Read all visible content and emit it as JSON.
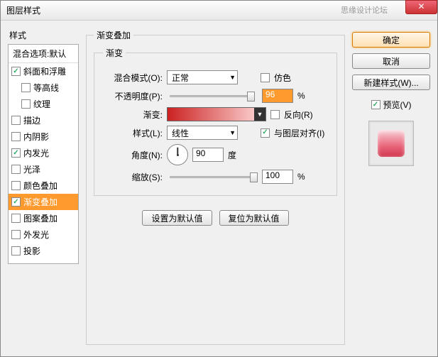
{
  "title": "图层样式",
  "watermark": "思缘设计论坛",
  "left": {
    "header": "样式",
    "blend_options": "混合选项:默认",
    "items": [
      {
        "label": "斜面和浮雕",
        "checked": true,
        "indent": false
      },
      {
        "label": "等高线",
        "checked": false,
        "indent": true
      },
      {
        "label": "纹理",
        "checked": false,
        "indent": true
      },
      {
        "label": "描边",
        "checked": false,
        "indent": false
      },
      {
        "label": "内阴影",
        "checked": false,
        "indent": false
      },
      {
        "label": "内发光",
        "checked": true,
        "indent": false
      },
      {
        "label": "光泽",
        "checked": false,
        "indent": false
      },
      {
        "label": "颜色叠加",
        "checked": false,
        "indent": false
      },
      {
        "label": "渐变叠加",
        "checked": true,
        "indent": false,
        "selected": true
      },
      {
        "label": "图案叠加",
        "checked": false,
        "indent": false
      },
      {
        "label": "外发光",
        "checked": false,
        "indent": false
      },
      {
        "label": "投影",
        "checked": false,
        "indent": false
      }
    ]
  },
  "center": {
    "group_title": "渐变叠加",
    "subgroup_title": "渐变",
    "blend_mode_label": "混合模式(O):",
    "blend_mode_value": "正常",
    "dither_label": "仿色",
    "opacity_label": "不透明度(P):",
    "opacity_value": "96",
    "percent": "%",
    "gradient_label": "渐变:",
    "reverse_label": "反向(R)",
    "style_label": "样式(L):",
    "style_value": "线性",
    "align_label": "与图层对齐(I)",
    "angle_label": "角度(N):",
    "angle_value": "90",
    "degree": "度",
    "scale_label": "缩放(S):",
    "scale_value": "100",
    "set_default": "设置为默认值",
    "reset_default": "复位为默认值"
  },
  "right": {
    "ok": "确定",
    "cancel": "取消",
    "new_style": "新建样式(W)...",
    "preview": "预览(V)"
  }
}
